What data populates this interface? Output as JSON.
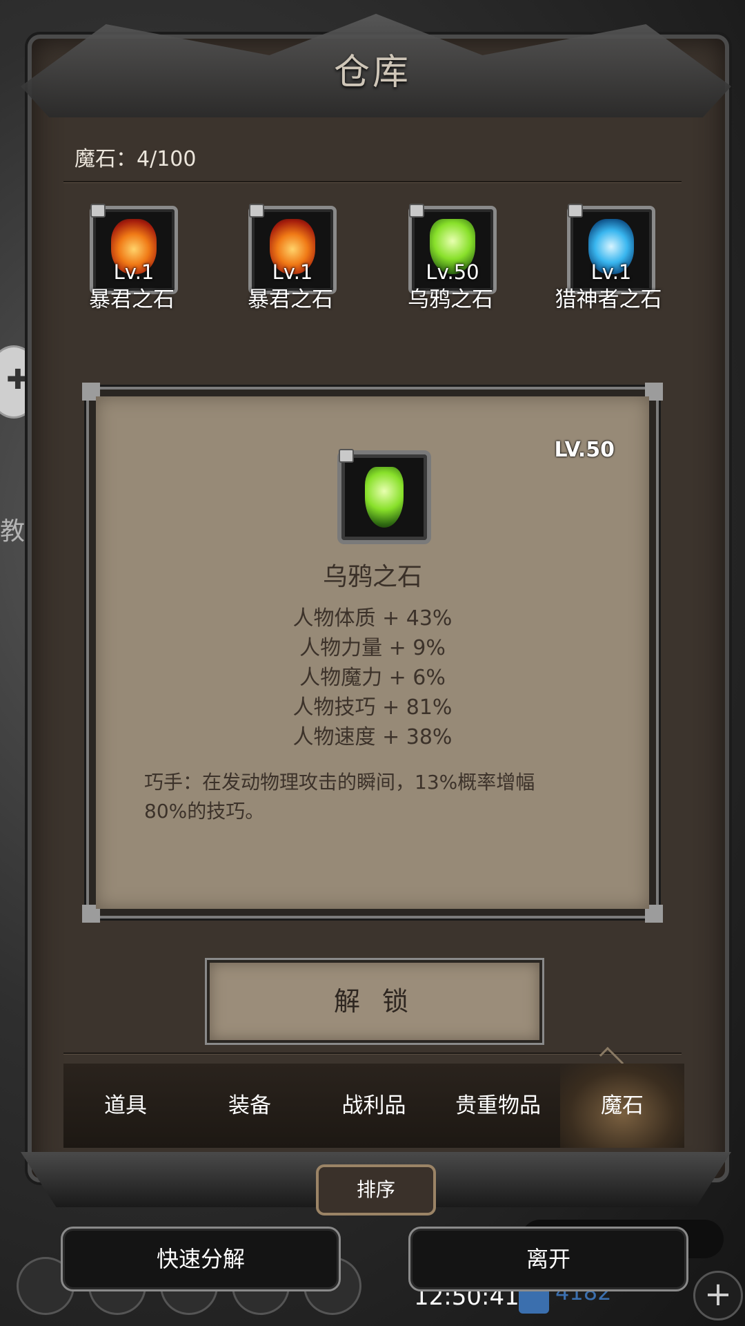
{
  "window": {
    "title": "仓库"
  },
  "inventory": {
    "magic_stone_count_label": "魔石：4/100"
  },
  "stones": [
    {
      "level": "Lv.1",
      "name": "暴君之石",
      "gem": "fire"
    },
    {
      "level": "Lv.1",
      "name": "暴君之石",
      "gem": "fire"
    },
    {
      "level": "Lv.50",
      "name": "乌鸦之石",
      "gem": "green"
    },
    {
      "level": "Lv.1",
      "name": "猎神者之石",
      "gem": "blue"
    }
  ],
  "detail": {
    "level": "LV.50",
    "name": "乌鸦之石",
    "stats": [
      "人物体质 + 43%",
      "人物力量 + 9%",
      "人物魔力 + 6%",
      "人物技巧 + 81%",
      "人物速度 + 38%"
    ],
    "description_line1": "巧手：在发动物理攻击的瞬间，13%概率增幅",
    "description_line2": "80%的技巧。"
  },
  "actions": {
    "unlock_label": "解 锁",
    "sort_label": "排序"
  },
  "tabs": [
    {
      "label": "道具"
    },
    {
      "label": "装备"
    },
    {
      "label": "战利品"
    },
    {
      "label": "贵重物品"
    },
    {
      "label": "魔石",
      "active": true
    }
  ],
  "bottom": {
    "quick_disassemble_label": "快速分解",
    "leave_label": "离开",
    "time": "12:50:41",
    "currency": "4182"
  },
  "background": {
    "side_text": "教"
  }
}
